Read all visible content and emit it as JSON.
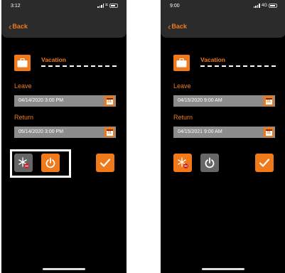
{
  "colors": {
    "accent": "#f07a1a",
    "field": "#8c8c8c",
    "nav": "#2b2b2b"
  },
  "screens": [
    {
      "status": {
        "time": "3:12",
        "network": ""
      },
      "nav": {
        "back_label": "Back"
      },
      "vacation_label": "Vacation",
      "leave": {
        "label": "Leave",
        "value": "04/14/2020   3:00 PM"
      },
      "return": {
        "label": "Return",
        "value": "05/14/2020   3:00 PM"
      },
      "calendar_day": "31",
      "icons": [
        "briefcase-icon",
        "snowflake-off-icon",
        "power-icon",
        "checkmark-icon",
        "calendar-icon"
      ],
      "power_active": true,
      "highlighted": true
    },
    {
      "status": {
        "time": "9:00",
        "network": "4G"
      },
      "nav": {
        "back_label": "Back"
      },
      "vacation_label": "Vacation",
      "leave": {
        "label": "Leave",
        "value": "04/15/2020   9:00 AM"
      },
      "return": {
        "label": "Return",
        "value": "04/15/2021   9:00 AM"
      },
      "calendar_day": "31",
      "icons": [
        "briefcase-icon",
        "snowflake-off-icon",
        "power-icon",
        "checkmark-icon",
        "calendar-icon"
      ],
      "power_active": false,
      "highlighted": false
    }
  ]
}
